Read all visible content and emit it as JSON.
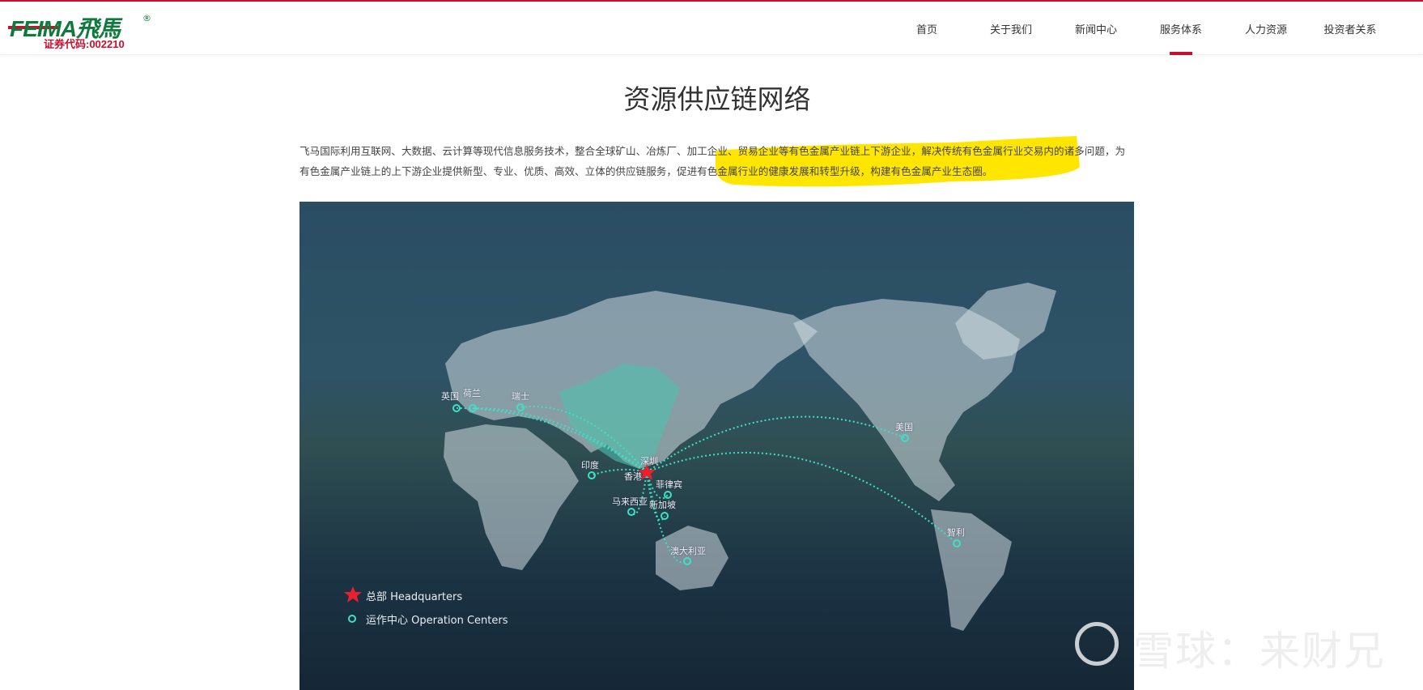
{
  "logo": {
    "brand": "FEIMA飛馬",
    "registered": "®",
    "stock_code": "证券代码:002210"
  },
  "nav": {
    "items": [
      "首页",
      "关于我们",
      "新闻中心",
      "服务体系",
      "人力资源",
      "投资者关系"
    ],
    "active": "服务体系"
  },
  "page_title": "资源供应链网络",
  "intro": "飞马国际利用互联网、大数据、云计算等现代信息服务技术，整合全球矿山、冶炼厂、加工企业、贸易企业等有色金属产业链上下游企业，解决传统有色金属行业交易内的诸多问题，为有色金属产业链上的上下游企业提供新型、专业、优质、高效、立体的供应链服务，促进有色金属行业的健康发展和转型升级，构建有色金属产业生态圈。",
  "map": {
    "hq": "深圳",
    "hk": "香港",
    "centers": [
      "英国",
      "荷兰",
      "瑞士",
      "美国",
      "印度",
      "菲律宾",
      "马来西亚",
      "新加坡",
      "澳大利亚",
      "智利"
    ],
    "legend": {
      "hq": "总部 Headquarters",
      "centers": "运作中心 Operation Centers"
    },
    "colors": {
      "route": "#3fe0c5",
      "hq": "#e8202f",
      "china": "#4fbfae"
    }
  },
  "watermark": "雪球：来财兄"
}
